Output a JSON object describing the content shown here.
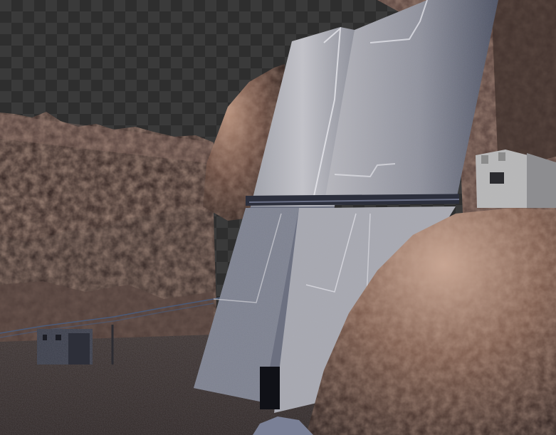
{
  "viewport": {
    "background": "transparent-checkerboard",
    "checker_light": "#3a3a3a",
    "checker_dark": "#2e2e2e"
  },
  "scene": {
    "kind": "3d-render",
    "subject": "sci-fi-bunker-door",
    "colors": {
      "rock_dark": "#2b2321",
      "rock_mid": "#4a3a35",
      "rock_light": "#8a6a5a",
      "rock_highlight": "#c8a48f",
      "ground": "#3a3230",
      "panel_light": "#b8b8bf",
      "panel_mid": "#8e8f98",
      "panel_shadow": "#4b5060",
      "concrete": "#b5b5b5"
    }
  }
}
